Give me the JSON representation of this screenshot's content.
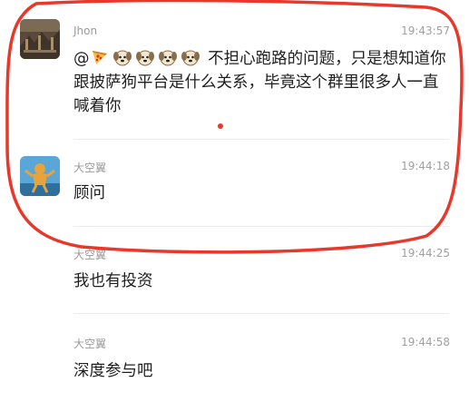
{
  "messages": [
    {
      "sender": "Jhon",
      "time": "19:43:57",
      "text_prefix": "@",
      "emoji_names": [
        "pizza-emoji",
        "dog-face-emoji",
        "dog-face-emoji",
        "dog-face-emoji",
        "dog-face-emoji"
      ],
      "text": "不担心跑路的问题，只是想知道你跟披萨狗平台是什么关系，毕竟这个群里很多人一直喊着你"
    },
    {
      "sender": "大空翼",
      "time": "19:44:18",
      "text": "顾问"
    },
    {
      "sender": "大空翼",
      "time": "19:44:25",
      "text": "我也有投资"
    },
    {
      "sender": "大空翼",
      "time": "19:44:58",
      "text": "深度参与吧"
    }
  ],
  "colors": {
    "annotation": "#e8382a",
    "meta_text": "#9b9b9b",
    "divider": "#ebebeb"
  }
}
